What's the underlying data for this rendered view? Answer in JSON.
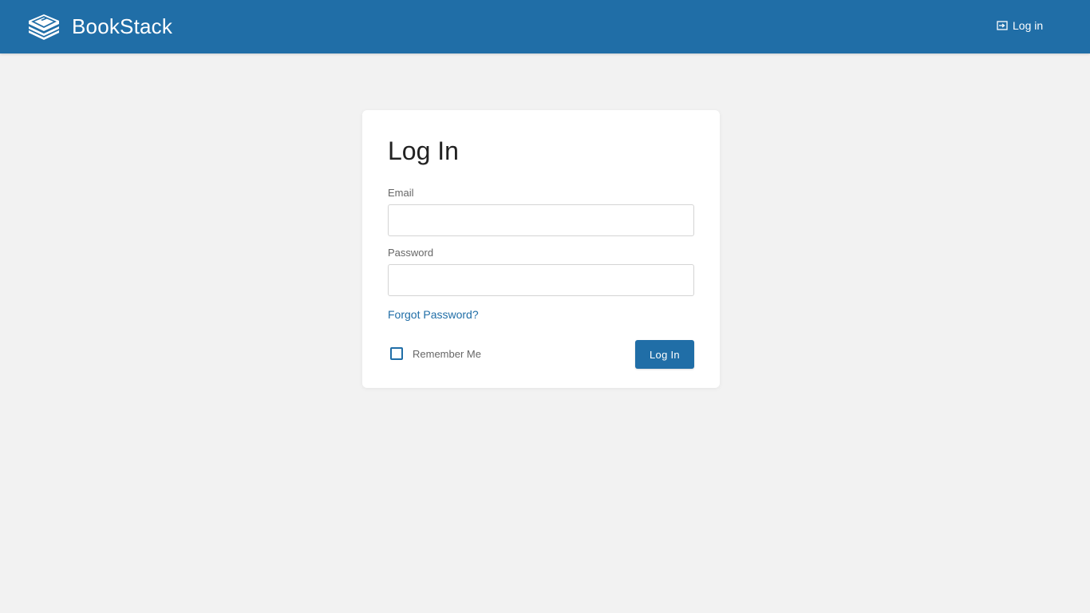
{
  "header": {
    "app_name": "BookStack",
    "logo_icon": "bookstack-logo-icon",
    "login_icon": "login-icon",
    "login_label": "Log in"
  },
  "login_form": {
    "title": "Log In",
    "email_label": "Email",
    "email_value": "",
    "password_label": "Password",
    "password_value": "",
    "forgot_password_label": "Forgot Password?",
    "remember_me_label": "Remember Me",
    "remember_me_checked": false,
    "submit_label": "Log In"
  },
  "colors": {
    "primary": "#206ea7",
    "background": "#f2f2f2",
    "card": "#ffffff"
  }
}
